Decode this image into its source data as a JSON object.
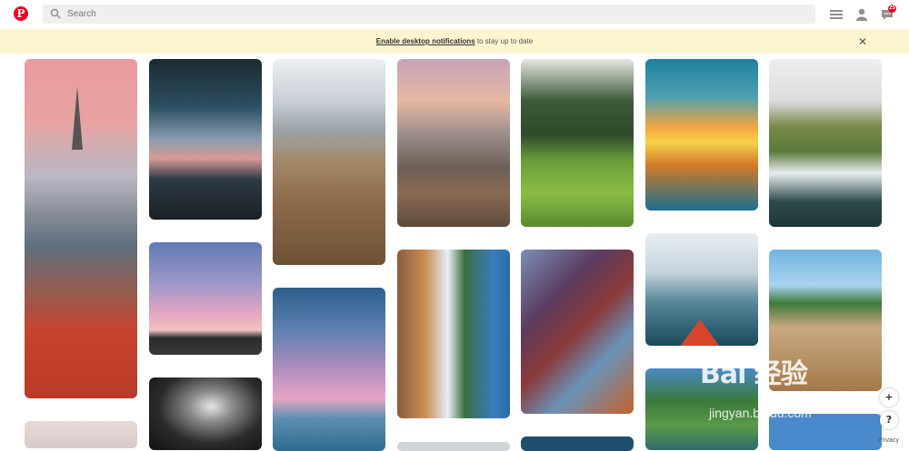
{
  "search": {
    "placeholder": "Search"
  },
  "header": {
    "message_count": "25"
  },
  "notification": {
    "link_text": "Enable desktop notifications",
    "message_text": " to stay up to date"
  },
  "footer": {
    "help_label": "?",
    "add_label": "+",
    "privacy_label": "Privacy"
  },
  "watermark": {
    "line1": "Bai 经验",
    "line2": "jingyan.baidu.com"
  },
  "colors": {
    "brand": "#e60023",
    "banner": "#fdf5d2"
  }
}
